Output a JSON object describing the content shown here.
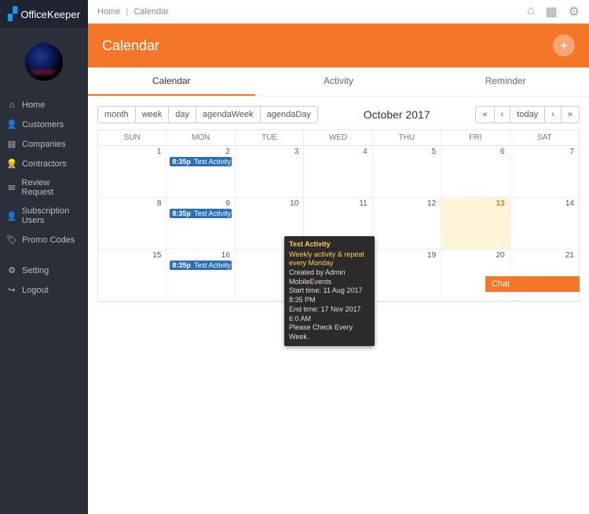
{
  "brand": "OfficeKeeper",
  "breadcrumb": {
    "home": "Home",
    "current": "Calendar"
  },
  "sidebar": {
    "items": [
      {
        "icon": "⌂",
        "label": "Home"
      },
      {
        "icon": "👤",
        "label": "Customers"
      },
      {
        "icon": "▤",
        "label": "Companies"
      },
      {
        "icon": "👷",
        "label": "Contractors"
      },
      {
        "icon": "✉",
        "label": "Review Request"
      },
      {
        "icon": "👤",
        "label": "Subscription Users"
      },
      {
        "icon": "🏷",
        "label": "Promo Codes"
      }
    ],
    "footer": [
      {
        "icon": "⚙",
        "label": "Setting"
      },
      {
        "icon": "↪",
        "label": "Logout"
      }
    ]
  },
  "page": {
    "title": "Calendar"
  },
  "tabs": [
    {
      "label": "Calendar",
      "active": true
    },
    {
      "label": "Activity",
      "active": false
    },
    {
      "label": "Reminder",
      "active": false
    }
  ],
  "calendar": {
    "views": [
      "month",
      "week",
      "day",
      "agendaWeek",
      "agendaDay"
    ],
    "title": "October 2017",
    "nav": {
      "first": "«",
      "prev": "‹",
      "today": "today",
      "next": "›",
      "last": "»"
    },
    "daynames": [
      "SUN",
      "MON",
      "TUE",
      "WED",
      "THU",
      "FRI",
      "SAT"
    ],
    "rows": [
      [
        1,
        2,
        3,
        4,
        5,
        6,
        7
      ],
      [
        8,
        9,
        10,
        11,
        12,
        13,
        14
      ],
      [
        15,
        16,
        17,
        18,
        19,
        20,
        21
      ]
    ],
    "today": 13,
    "events": [
      {
        "row": 0,
        "col": 1,
        "time": "8:35p",
        "title": "Test Activity"
      },
      {
        "row": 1,
        "col": 1,
        "time": "8:35p",
        "title": "Test Activity"
      },
      {
        "row": 2,
        "col": 1,
        "time": "8:35p",
        "title": "Test Activity"
      }
    ]
  },
  "tooltip": {
    "title": "Test Activity",
    "sub": "Weekly activity & repeat every Monday",
    "created": "Created by Admin MobileEvents",
    "start": "Start time: 11 Aug 2017 8:35 PM",
    "end": "End time: 17 Nov 2017 6:0 AM",
    "note": "Please Check Every Week."
  },
  "chat": {
    "label": "Chat"
  }
}
